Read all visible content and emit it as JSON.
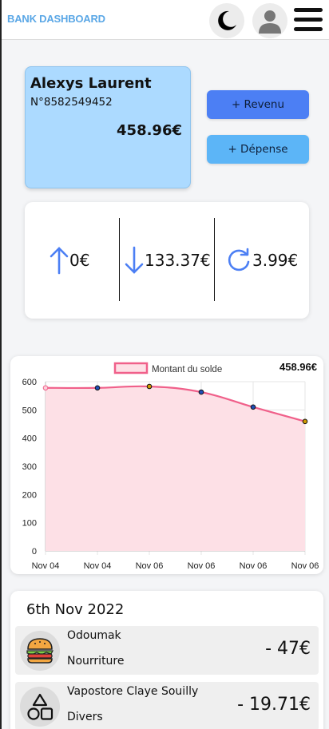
{
  "header": {
    "brand": "BANK DASHBOARD",
    "icons": [
      "moon-icon",
      "user-avatar-icon",
      "hamburger-menu-icon"
    ]
  },
  "account": {
    "name": "Alexys Laurent",
    "number": "N°8582549452",
    "balance": "458.96€"
  },
  "actions": {
    "revenu_label": "+ Revenu",
    "depense_label": "+ Dépense"
  },
  "stats": {
    "income": "0€",
    "expenses": "133.37€",
    "recurring": "3.99€"
  },
  "colors": {
    "accent": "#4c7ff4",
    "card_blue": "#acdaff",
    "line": "#f0608a",
    "fill": "#fde0e6"
  },
  "chart_data": {
    "type": "area",
    "legend": "Montant du solde",
    "headline": "458.96€",
    "x": [
      "Nov 04",
      "Nov 04",
      "Nov 06",
      "Nov 06",
      "Nov 06",
      "Nov 06"
    ],
    "series": [
      {
        "name": "Montant du solde",
        "values": [
          578,
          578,
          583,
          563,
          510,
          459
        ]
      }
    ],
    "ylim": [
      0,
      600
    ],
    "yticks": [
      0,
      100,
      200,
      300,
      400,
      500,
      600
    ],
    "grid": true,
    "legend_position": "top-center"
  },
  "transactions": {
    "date": "6th Nov 2022",
    "items": [
      {
        "name": "Odoumak",
        "category": "Nourriture",
        "amount": "- 47€",
        "icon": "burger-icon"
      },
      {
        "name": "Vapostore Claye Souilly",
        "category": "Divers",
        "amount": "- 19.71€",
        "icon": "shapes-icon"
      }
    ]
  }
}
